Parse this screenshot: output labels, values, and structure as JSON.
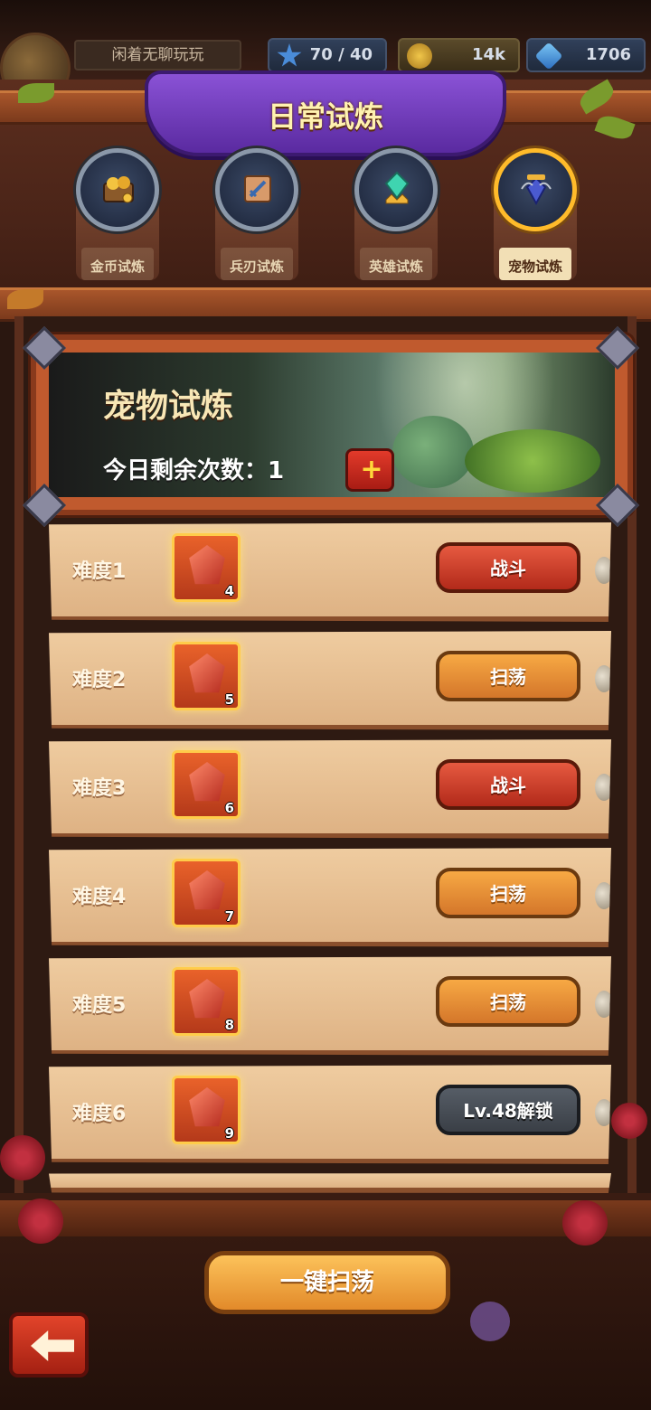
{
  "top": {
    "player_name": "闲着无聊玩玩",
    "stamina": "70 / 40",
    "gold": "14k",
    "gems": "1706"
  },
  "title": "日常试炼",
  "tabs": [
    {
      "label": "金币试炼",
      "icon": "gold-chest-icon",
      "active": false
    },
    {
      "label": "兵刃试炼",
      "icon": "weapon-scroll-icon",
      "active": false
    },
    {
      "label": "英雄试炼",
      "icon": "hero-crystal-icon",
      "active": false
    },
    {
      "label": "宠物试炼",
      "icon": "pet-crystal-icon",
      "active": true
    }
  ],
  "hero": {
    "title": "宠物试炼",
    "count_text": "今日剩余次数：1",
    "add_icon": "plus-icon"
  },
  "rows": [
    {
      "label": "难度1",
      "item_count": "4",
      "action": "战斗",
      "state": "battle"
    },
    {
      "label": "难度2",
      "item_count": "5",
      "action": "扫荡",
      "state": "sweep"
    },
    {
      "label": "难度3",
      "item_count": "6",
      "action": "战斗",
      "state": "battle"
    },
    {
      "label": "难度4",
      "item_count": "7",
      "action": "扫荡",
      "state": "sweep"
    },
    {
      "label": "难度5",
      "item_count": "8",
      "action": "扫荡",
      "state": "sweep"
    },
    {
      "label": "难度6",
      "item_count": "9",
      "action": "Lv.48解锁",
      "state": "locked"
    }
  ],
  "sweep_all": "一键扫荡",
  "colors": {
    "battle": "#c9361f",
    "sweep": "#e58f34",
    "locked": "#474d55",
    "title_banner": "#6f3cc0"
  }
}
